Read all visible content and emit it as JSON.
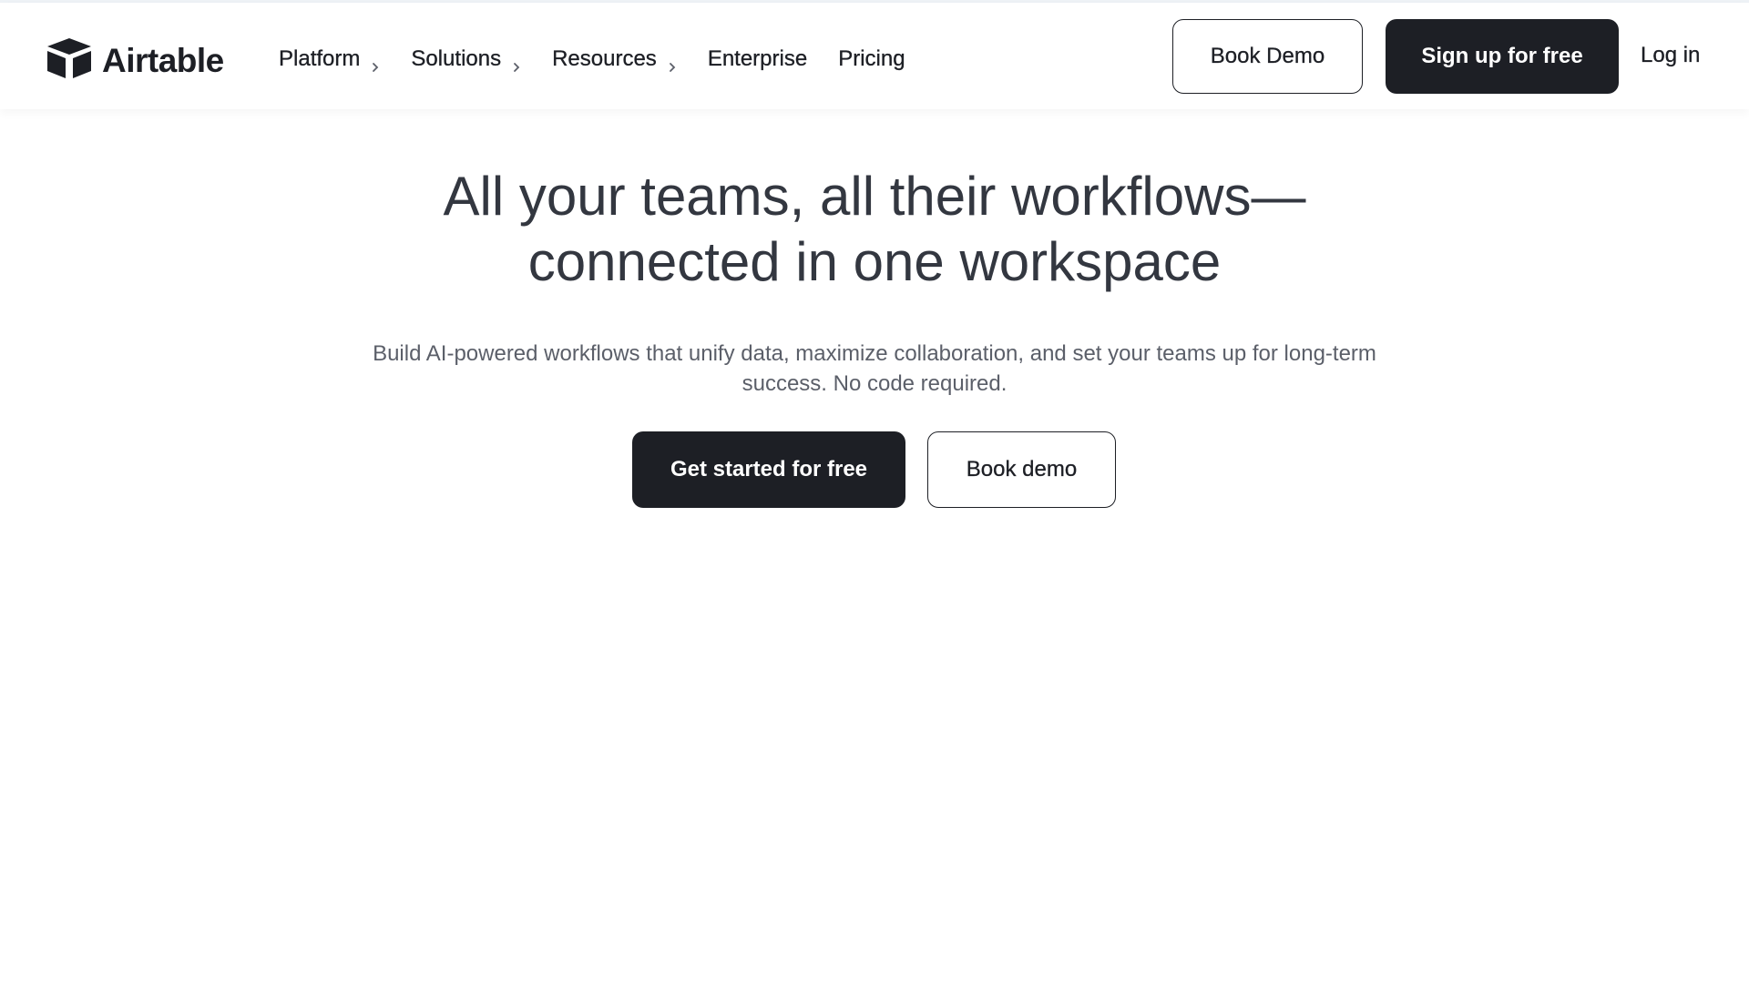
{
  "header": {
    "logo_text": "Airtable",
    "nav": [
      {
        "label": "Platform",
        "has_chevron": true
      },
      {
        "label": "Solutions",
        "has_chevron": true
      },
      {
        "label": "Resources",
        "has_chevron": true
      },
      {
        "label": "Enterprise",
        "has_chevron": false
      },
      {
        "label": "Pricing",
        "has_chevron": false
      }
    ],
    "book_demo_label": "Book Demo",
    "signup_label": "Sign up for free",
    "login_label": "Log in"
  },
  "hero": {
    "title_line1": "All your teams, all their workflows—",
    "title_line2": "connected in one workspace",
    "subtitle_line1": "Build AI-powered workflows that unify data, maximize collaboration, and set your teams up for long-term",
    "subtitle_line2": "success. No code required.",
    "primary_cta": "Get started for free",
    "secondary_cta": "Book demo"
  },
  "colors": {
    "brand_dark": "#1d1f25",
    "heading": "#333740",
    "body_text": "#5b5f69",
    "background": "#ffffff"
  },
  "icons": {
    "logo": "airtable-box-logo-icon",
    "nav_chevron": "chevron-right-icon"
  }
}
